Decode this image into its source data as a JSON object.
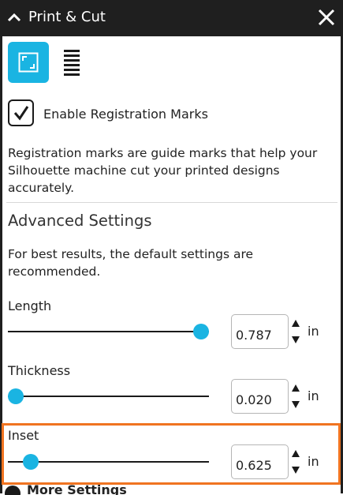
{
  "titlebar": {
    "title": "Print & Cut"
  },
  "mode_buttons": [
    {
      "icon": "registration-marks-icon",
      "active": true
    },
    {
      "icon": "lines-icon",
      "active": false
    }
  ],
  "registration": {
    "checkbox_checked": true,
    "label": "Enable Registration Marks",
    "description": "Registration marks are guide marks that help your Silhouette machine cut your printed designs accurately."
  },
  "advanced": {
    "title": "Advanced Settings",
    "description": "For best results, the default settings are recommended."
  },
  "settings": [
    {
      "label": "Length",
      "value": "0.787",
      "unit": "in",
      "slider_fraction": 1.0
    },
    {
      "label": "Thickness",
      "value": "0.020",
      "unit": "in",
      "slider_fraction": 0.0
    },
    {
      "label": "Inset",
      "value": "0.625",
      "unit": "in",
      "slider_fraction": 0.08
    }
  ],
  "more_settings": {
    "label": "More Settings"
  },
  "colors": {
    "accent": "#1ab4e2",
    "titlebar": "#1f1f1f",
    "highlight": "#f07421"
  }
}
